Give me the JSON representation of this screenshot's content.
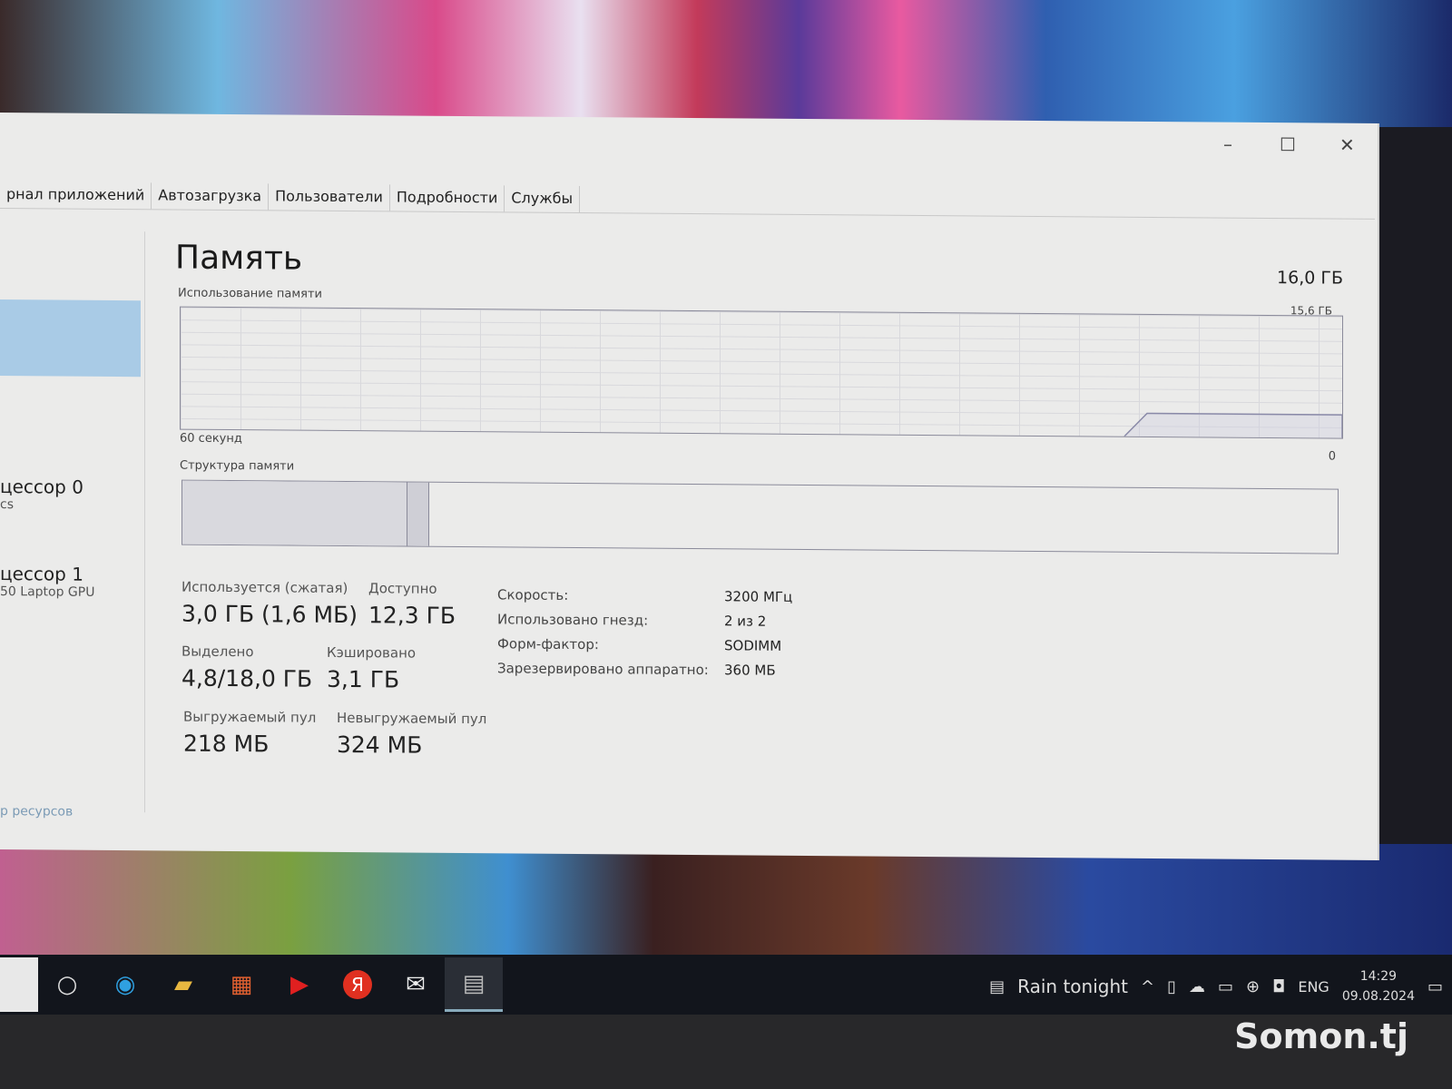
{
  "window": {
    "controls": {
      "minimize": "–",
      "maximize": "☐",
      "close": "✕"
    },
    "tabs": [
      "рнал приложений",
      "Автозагрузка",
      "Пользователи",
      "Подробности",
      "Службы"
    ]
  },
  "sidebar": {
    "items": [
      {
        "title": "цессор 0",
        "sub": "cs"
      },
      {
        "title": "цессор 1",
        "sub": "50 Laptop GPU"
      }
    ],
    "link": "р ресурсов"
  },
  "memory": {
    "title": "Память",
    "total": "16,0 ГБ",
    "usage_label": "Использование памяти",
    "graph_max": "15,6 ГБ",
    "graph_time": "60 секунд",
    "graph_min": "0",
    "structure_label": "Структура памяти",
    "usage_percent": 19
  },
  "stats": [
    {
      "label": "Используется (сжатая)",
      "value": "3,0 ГБ (1,6 МБ)"
    },
    {
      "label": "Доступно",
      "value": "12,3 ГБ"
    },
    {
      "label": "Выделено",
      "value": "4,8/18,0 ГБ"
    },
    {
      "label": "Кэшировано",
      "value": "3,1 ГБ"
    },
    {
      "label": "Выгружаемый пул",
      "value": "218 МБ"
    },
    {
      "label": "Невыгружаемый пул",
      "value": "324 МБ"
    }
  ],
  "props": [
    {
      "k": "Скорость:",
      "v": "3200 МГц"
    },
    {
      "k": "Использовано гнезд:",
      "v": "2 из 2"
    },
    {
      "k": "Форм-фактор:",
      "v": "SODIMM"
    },
    {
      "k": "Зарезервировано аппаратно:",
      "v": "360 МБ"
    }
  ],
  "taskbar": {
    "icons": [
      "search-icon",
      "edge-icon",
      "file-explorer-icon",
      "store-icon",
      "youtube-icon",
      "yandex-icon",
      "mail-icon",
      "task-manager-icon"
    ],
    "weather": "Rain tonight",
    "lang": "ENG",
    "time": "14:29",
    "date": "09.08.2024"
  },
  "watermark": "Somon.tj"
}
